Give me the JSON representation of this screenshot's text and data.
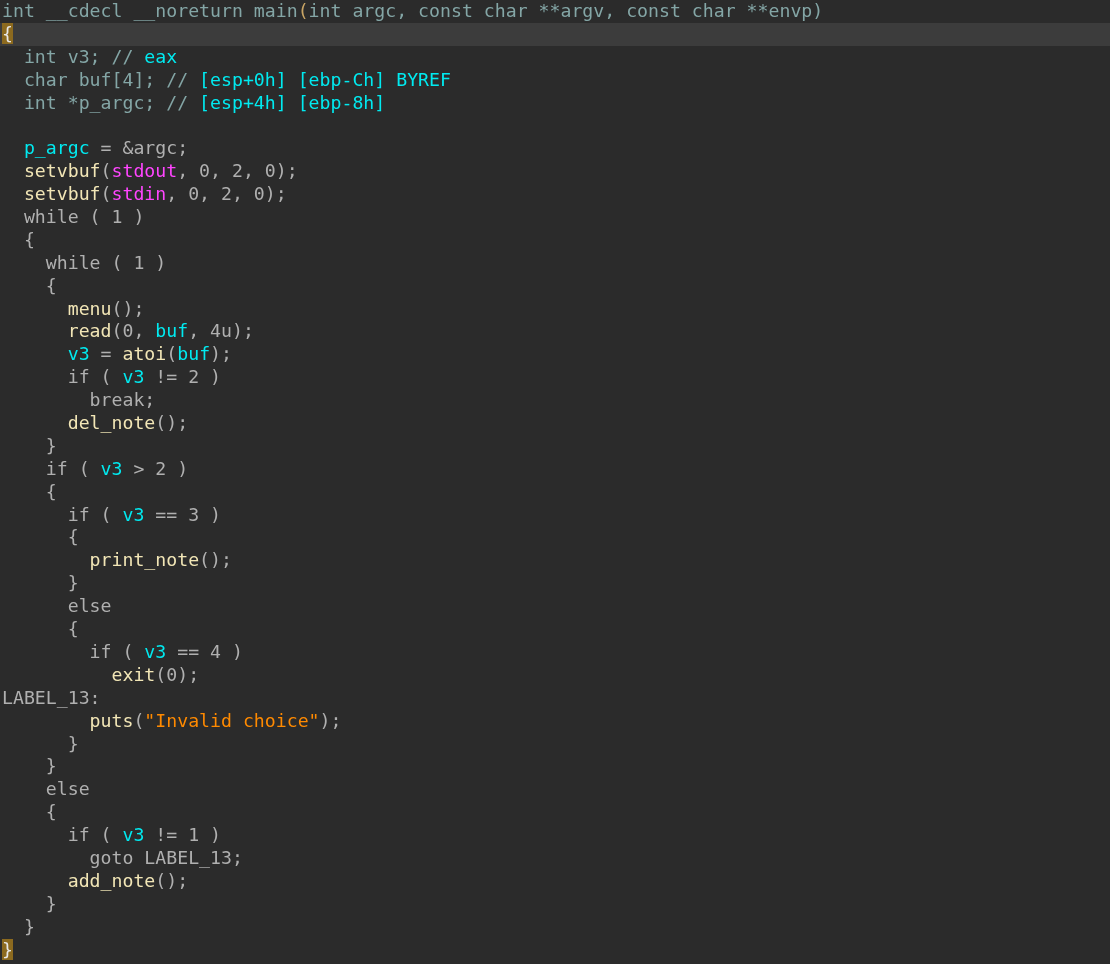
{
  "code_view": {
    "lines": [
      {
        "current": false,
        "tokens": [
          {
            "kind": "decl",
            "text": "int __cdecl __noreturn main"
          },
          {
            "kind": "paren",
            "text": "("
          },
          {
            "kind": "decl",
            "text": "int argc, const char **argv, const char **envp)"
          }
        ]
      },
      {
        "current": true,
        "tokens": [
          {
            "kind": "match",
            "text": "{"
          }
        ]
      },
      {
        "current": false,
        "tokens": [
          {
            "kind": "decl",
            "text": "  int v3; // "
          },
          {
            "kind": "var",
            "text": "eax"
          }
        ]
      },
      {
        "current": false,
        "tokens": [
          {
            "kind": "decl",
            "text": "  char buf[4]; // "
          },
          {
            "kind": "var",
            "text": "[esp+0h] [ebp-Ch] BYREF"
          }
        ]
      },
      {
        "current": false,
        "tokens": [
          {
            "kind": "decl",
            "text": "  int *p_argc; // "
          },
          {
            "kind": "var",
            "text": "[esp+4h] [ebp-8h]"
          }
        ]
      },
      {
        "current": false
      },
      {
        "current": false,
        "tokens": [
          {
            "kind": "var",
            "text": "  p_argc"
          },
          {
            "kind": "code",
            "text": " = &argc;"
          }
        ]
      },
      {
        "current": false,
        "tokens": [
          {
            "kind": "func",
            "text": "  setvbuf"
          },
          {
            "kind": "code",
            "text": "("
          },
          {
            "kind": "global",
            "text": "stdout"
          },
          {
            "kind": "code",
            "text": ", 0, 2, 0);"
          }
        ]
      },
      {
        "current": false,
        "tokens": [
          {
            "kind": "func",
            "text": "  setvbuf"
          },
          {
            "kind": "code",
            "text": "("
          },
          {
            "kind": "global",
            "text": "stdin"
          },
          {
            "kind": "code",
            "text": ", 0, 2, 0);"
          }
        ]
      },
      {
        "current": false,
        "tokens": [
          {
            "kind": "code",
            "text": "  while ( 1 )"
          }
        ]
      },
      {
        "current": false,
        "tokens": [
          {
            "kind": "code",
            "text": "  {"
          }
        ]
      },
      {
        "current": false,
        "tokens": [
          {
            "kind": "code",
            "text": "    while ( 1 )"
          }
        ]
      },
      {
        "current": false,
        "tokens": [
          {
            "kind": "code",
            "text": "    {"
          }
        ]
      },
      {
        "current": false,
        "tokens": [
          {
            "kind": "func",
            "text": "      menu"
          },
          {
            "kind": "code",
            "text": "();"
          }
        ]
      },
      {
        "current": false,
        "tokens": [
          {
            "kind": "func",
            "text": "      read"
          },
          {
            "kind": "code",
            "text": "(0, "
          },
          {
            "kind": "var",
            "text": "buf"
          },
          {
            "kind": "code",
            "text": ", 4u);"
          }
        ]
      },
      {
        "current": false,
        "tokens": [
          {
            "kind": "var",
            "text": "      v3"
          },
          {
            "kind": "code",
            "text": " = "
          },
          {
            "kind": "func",
            "text": "atoi"
          },
          {
            "kind": "code",
            "text": "("
          },
          {
            "kind": "var",
            "text": "buf"
          },
          {
            "kind": "code",
            "text": ");"
          }
        ]
      },
      {
        "current": false,
        "tokens": [
          {
            "kind": "code",
            "text": "      if ( "
          },
          {
            "kind": "var",
            "text": "v3"
          },
          {
            "kind": "code",
            "text": " != 2 )"
          }
        ]
      },
      {
        "current": false,
        "tokens": [
          {
            "kind": "code",
            "text": "        break;"
          }
        ]
      },
      {
        "current": false,
        "tokens": [
          {
            "kind": "func",
            "text": "      del_note"
          },
          {
            "kind": "code",
            "text": "();"
          }
        ]
      },
      {
        "current": false,
        "tokens": [
          {
            "kind": "code",
            "text": "    }"
          }
        ]
      },
      {
        "current": false,
        "tokens": [
          {
            "kind": "code",
            "text": "    if ( "
          },
          {
            "kind": "var",
            "text": "v3"
          },
          {
            "kind": "code",
            "text": " > 2 )"
          }
        ]
      },
      {
        "current": false,
        "tokens": [
          {
            "kind": "code",
            "text": "    {"
          }
        ]
      },
      {
        "current": false,
        "tokens": [
          {
            "kind": "code",
            "text": "      if ( "
          },
          {
            "kind": "var",
            "text": "v3"
          },
          {
            "kind": "code",
            "text": " == 3 )"
          }
        ]
      },
      {
        "current": false,
        "tokens": [
          {
            "kind": "code",
            "text": "      {"
          }
        ]
      },
      {
        "current": false,
        "tokens": [
          {
            "kind": "func",
            "text": "        print_note"
          },
          {
            "kind": "code",
            "text": "();"
          }
        ]
      },
      {
        "current": false,
        "tokens": [
          {
            "kind": "code",
            "text": "      }"
          }
        ]
      },
      {
        "current": false,
        "tokens": [
          {
            "kind": "code",
            "text": "      else"
          }
        ]
      },
      {
        "current": false,
        "tokens": [
          {
            "kind": "code",
            "text": "      {"
          }
        ]
      },
      {
        "current": false,
        "tokens": [
          {
            "kind": "code",
            "text": "        if ( "
          },
          {
            "kind": "var",
            "text": "v3"
          },
          {
            "kind": "code",
            "text": " == 4 )"
          }
        ]
      },
      {
        "current": false,
        "tokens": [
          {
            "kind": "func",
            "text": "          exit"
          },
          {
            "kind": "code",
            "text": "(0);"
          }
        ]
      },
      {
        "current": false,
        "tokens": [
          {
            "kind": "code",
            "text": "LABEL_13:"
          }
        ]
      },
      {
        "current": false,
        "tokens": [
          {
            "kind": "func",
            "text": "        puts"
          },
          {
            "kind": "code",
            "text": "("
          },
          {
            "kind": "string",
            "text": "\"Invalid choice\""
          },
          {
            "kind": "code",
            "text": ");"
          }
        ]
      },
      {
        "current": false,
        "tokens": [
          {
            "kind": "code",
            "text": "      }"
          }
        ]
      },
      {
        "current": false,
        "tokens": [
          {
            "kind": "code",
            "text": "    }"
          }
        ]
      },
      {
        "current": false,
        "tokens": [
          {
            "kind": "code",
            "text": "    else"
          }
        ]
      },
      {
        "current": false,
        "tokens": [
          {
            "kind": "code",
            "text": "    {"
          }
        ]
      },
      {
        "current": false,
        "tokens": [
          {
            "kind": "code",
            "text": "      if ( "
          },
          {
            "kind": "var",
            "text": "v3"
          },
          {
            "kind": "code",
            "text": " != 1 )"
          }
        ]
      },
      {
        "current": false,
        "tokens": [
          {
            "kind": "code",
            "text": "        goto LABEL_13;"
          }
        ]
      },
      {
        "current": false,
        "tokens": [
          {
            "kind": "func",
            "text": "      add_note"
          },
          {
            "kind": "code",
            "text": "();"
          }
        ]
      },
      {
        "current": false,
        "tokens": [
          {
            "kind": "code",
            "text": "    }"
          }
        ]
      },
      {
        "current": false,
        "tokens": [
          {
            "kind": "code",
            "text": "  }"
          }
        ]
      },
      {
        "current": false,
        "tokens": [
          {
            "kind": "match",
            "text": "}"
          }
        ]
      }
    ]
  }
}
